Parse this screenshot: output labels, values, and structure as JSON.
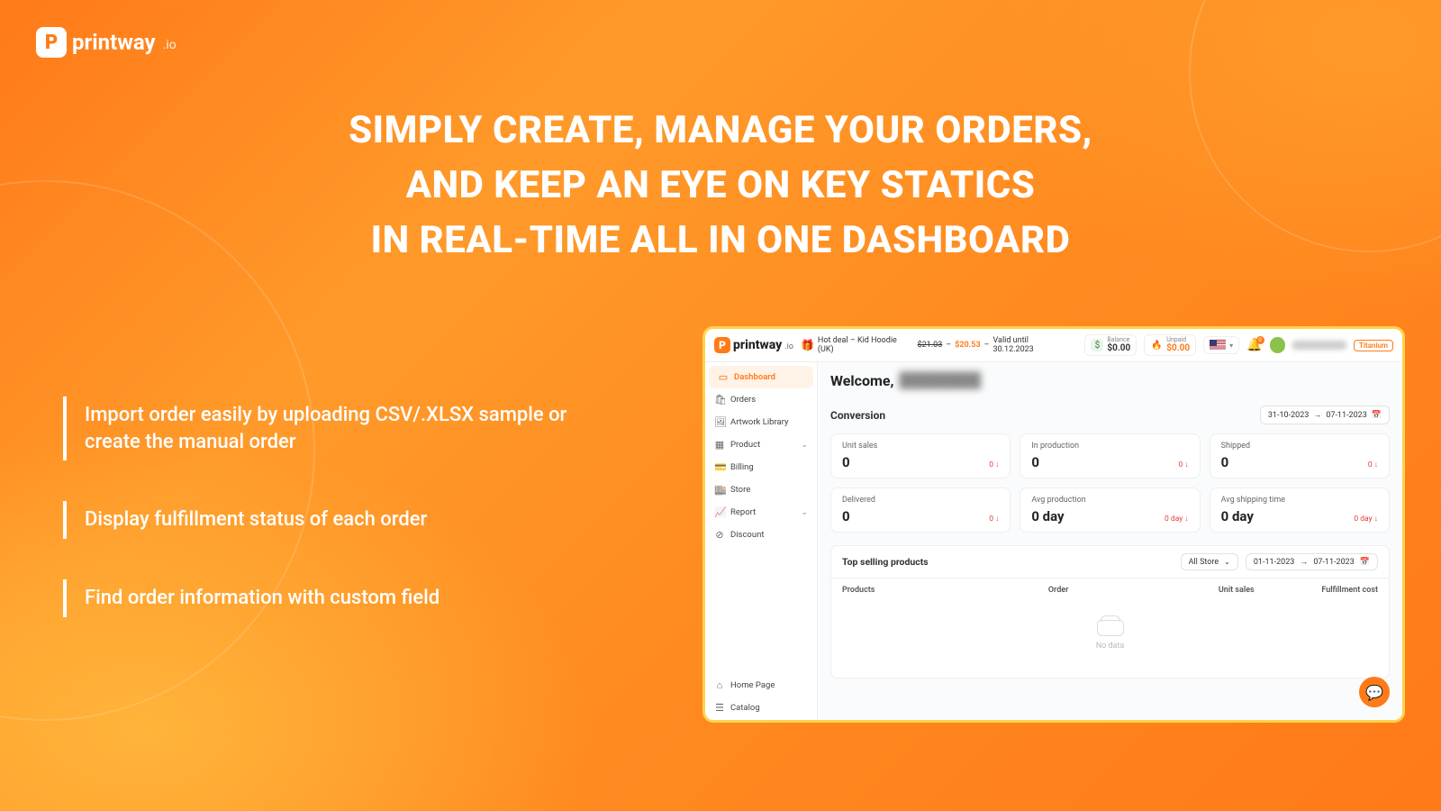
{
  "brand": {
    "name": "printway",
    "suffix": ".io",
    "badge": "P"
  },
  "hero": {
    "line1": "SIMPLY CREATE, MANAGE YOUR ORDERS,",
    "line2": "AND KEEP AN EYE ON KEY STATICS",
    "line3": "IN REAL-TIME ALL IN ONE DASHBOARD"
  },
  "bullets": [
    "Import order easily by uploading CSV/.XLSX sample or create the manual order",
    "Display fulfillment status of each order",
    "Find order information with custom field"
  ],
  "dashboard": {
    "hotdeal": {
      "prefix": "Hot deal – Kid Hoodie (UK)",
      "old_price": "$21.03",
      "new_price": "$20.53",
      "valid": "Valid until 30.12.2023"
    },
    "balance": {
      "label": "Balance",
      "value": "$0.00"
    },
    "unpaid": {
      "label": "Unpaid",
      "value": "$0.00"
    },
    "bell_count": "0",
    "tier": "Titanium",
    "nav": [
      {
        "icon": "▭",
        "label": "Dashboard",
        "active": true
      },
      {
        "icon": "🛍",
        "label": "Orders"
      },
      {
        "icon": "🖼",
        "label": "Artwork Library"
      },
      {
        "icon": "▦",
        "label": "Product",
        "expandable": true
      },
      {
        "icon": "💳",
        "label": "Billing"
      },
      {
        "icon": "🏬",
        "label": "Store"
      },
      {
        "icon": "📈",
        "label": "Report",
        "expandable": true
      },
      {
        "icon": "⊘",
        "label": "Discount"
      }
    ],
    "nav_bottom": [
      {
        "icon": "⌂",
        "label": "Home Page"
      },
      {
        "icon": "☰",
        "label": "Catalog"
      }
    ],
    "welcome": "Welcome,",
    "welcome_name": "████████",
    "conversion_title": "Conversion",
    "date_range": {
      "from": "31-10-2023",
      "to": "07-11-2023"
    },
    "cards": [
      {
        "label": "Unit sales",
        "value": "0",
        "delta": "0 ↓"
      },
      {
        "label": "In production",
        "value": "0",
        "delta": "0 ↓"
      },
      {
        "label": "Shipped",
        "value": "0",
        "delta": "0 ↓"
      },
      {
        "label": "Delivered",
        "value": "0",
        "delta": "0 ↓"
      },
      {
        "label": "Avg production",
        "value": "0 day",
        "delta": "0 day ↓"
      },
      {
        "label": "Avg shipping time",
        "value": "0 day",
        "delta": "0 day ↓"
      }
    ],
    "topselling": {
      "title": "Top selling products",
      "store_filter": "All Store",
      "date_range": {
        "from": "01-11-2023",
        "to": "07-11-2023"
      },
      "columns": [
        "Products",
        "Order",
        "Unit sales",
        "Fulfillment cost"
      ],
      "empty": "No data"
    }
  }
}
